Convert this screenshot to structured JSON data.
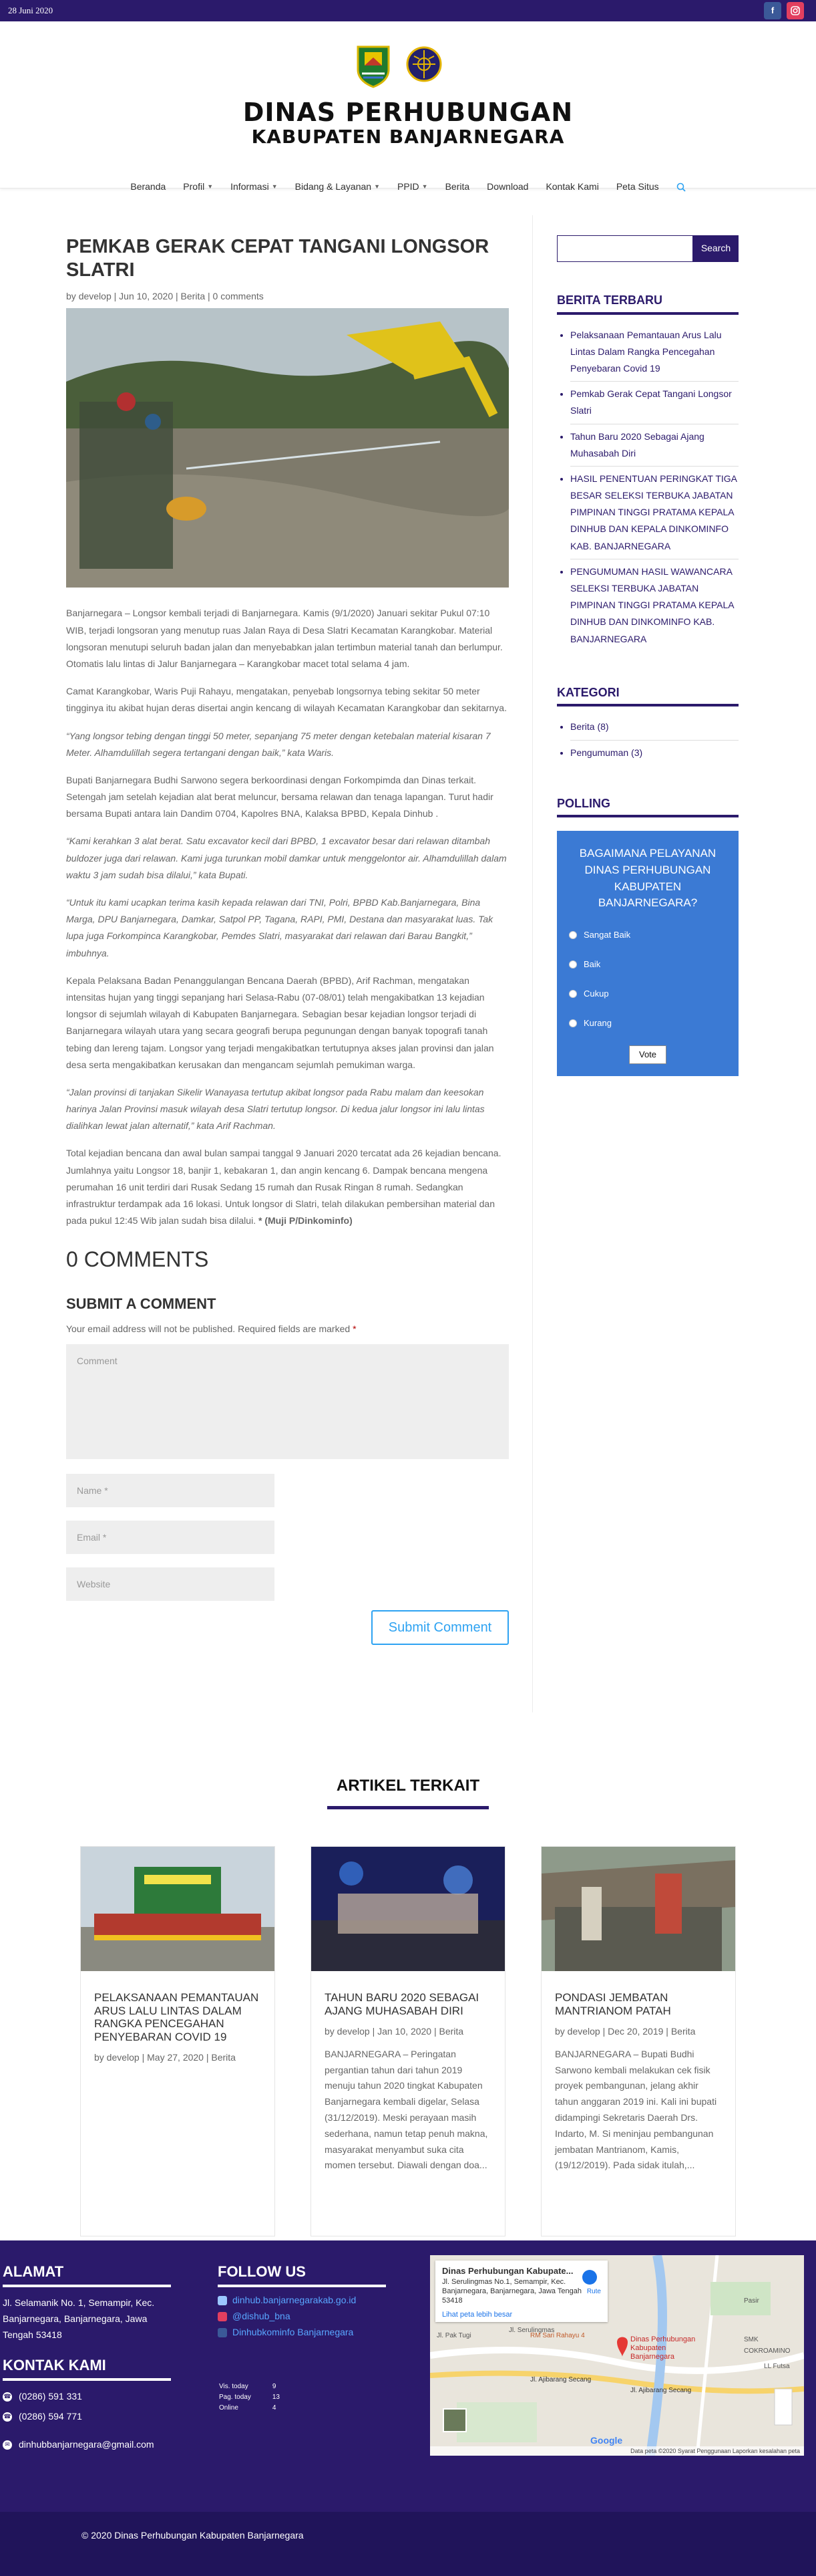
{
  "topbar": {
    "date": "28 Juni 2020",
    "facebook_icon": "facebook-icon",
    "instagram_icon": "instagram-icon"
  },
  "header": {
    "title_line1": "DINAS PERHUBUNGAN",
    "title_line2": "KABUPATEN BANJARNEGARA",
    "nav": [
      {
        "label": "Beranda"
      },
      {
        "label": "Profil"
      },
      {
        "label": "Informasi"
      },
      {
        "label": "Bidang & Layanan"
      },
      {
        "label": "PPID"
      },
      {
        "label": "Berita"
      },
      {
        "label": "Download"
      },
      {
        "label": "Kontak Kami"
      },
      {
        "label": "Peta Situs"
      }
    ]
  },
  "post": {
    "title": "PEMKAB GERAK CEPAT TANGANI LONGSOR SLATRI",
    "meta_author": "develop",
    "meta_date": "Jun 10, 2020",
    "meta_category": "Berita",
    "meta_comments": "0 comments",
    "sep": "|",
    "by": "by",
    "paragraphs": [
      {
        "text": "Banjarnegara – Longsor kembali terjadi di Banjarnegara. Kamis (9/1/2020) Januari sekitar Pukul 07:10 WIB, terjadi longsoran yang menutup ruas Jalan Raya di Desa Slatri Kecamatan Karangkobar. Material longsoran menutupi seluruh badan jalan dan menyebabkan jalan tertimbun material tanah dan berlumpur. Otomatis lalu lintas di Jalur Banjarnegara – Karangkobar macet total selama 4 jam.",
        "italic": false
      },
      {
        "text": "Camat Karangkobar, Waris Puji Rahayu, mengatakan, penyebab longsornya tebing sekitar 50 meter tingginya itu akibat hujan deras disertai angin kencang di wilayah Kecamatan Karangkobar dan sekitarnya.",
        "italic": false
      },
      {
        "text": "“Yang longsor tebing dengan tinggi 50 meter, sepanjang 75 meter dengan ketebalan material kisaran 7 Meter. Alhamdulillah segera tertangani dengan baik,” kata Waris.",
        "italic": true
      },
      {
        "text": "Bupati Banjarnegara Budhi Sarwono segera berkoordinasi dengan Forkompimda dan Dinas terkait. Setengah jam setelah kejadian alat berat meluncur, bersama relawan dan tenaga lapangan. Turut hadir bersama Bupati antara lain Dandim 0704, Kapolres BNA, Kalaksa BPBD, Kepala Dinhub .",
        "italic": false
      },
      {
        "text": "“Kami kerahkan 3 alat berat. Satu excavator kecil dari BPBD, 1 excavator besar dari relawan ditambah buldozer juga dari relawan. Kami juga turunkan mobil damkar untuk menggelontor air. Alhamdulillah dalam waktu 3 jam sudah bisa dilalui,” kata Bupati.",
        "italic": true
      },
      {
        "text": "“Untuk itu kami ucapkan terima kasih kepada relawan dari TNI, Polri, BPBD Kab.Banjarnegara, Bina Marga, DPU Banjarnegara, Damkar, Satpol PP, Tagana, RAPI, PMI, Destana dan masyarakat luas. Tak lupa juga Forkompinca Karangkobar, Pemdes Slatri, masyarakat dari relawan dari Barau Bangkit,” imbuhnya.",
        "italic": true
      },
      {
        "text": "Kepala Pelaksana Badan Penanggulangan Bencana Daerah (BPBD), Arif Rachman, mengatakan intensitas hujan yang tinggi sepanjang hari Selasa-Rabu (07-08/01) telah mengakibatkan 13 kejadian longsor di sejumlah wilayah di Kabupaten Banjarnegara. Sebagian besar kejadian longsor terjadi di Banjarnegara wilayah utara yang secara geografi berupa pegunungan dengan banyak topografi tanah tebing dan lereng tajam. Longsor yang terjadi mengakibatkan tertutupnya akses jalan provinsi dan jalan desa serta mengakibatkan kerusakan dan mengancam sejumlah pemukiman warga.",
        "italic": false
      },
      {
        "text": "“Jalan provinsi di tanjakan Sikelir Wanayasa tertutup akibat longsor pada Rabu malam dan keesokan harinya Jalan Provinsi masuk wilayah desa Slatri tertutup longsor. Di kedua jalur longsor ini lalu lintas dialihkan lewat jalan alternatif,” kata Arif Rachman.",
        "italic": true
      },
      {
        "text": "Total kejadian bencana dan awal bulan sampai tanggal 9 Januari 2020 tercatat ada 26 kejadian bencana. Jumlahnya yaitu Longsor 18, banjir 1, kebakaran 1, dan angin kencang 6. Dampak bencana mengena perumahan 16 unit terdiri dari Rusak Sedang 15 rumah dan Rusak Ringan 8 rumah. Sedangkan infrastruktur terdampak ada 16 lokasi. Untuk longsor di Slatri, telah dilakukan pembersihan material dan pada pukul 12:45 Wib jalan sudah bisa dilalui.",
        "italic": false,
        "credit": " * (Muji P/Dinkominfo)"
      }
    ]
  },
  "comments": {
    "heading": "0 COMMENTS",
    "submit_heading": "SUBMIT A COMMENT",
    "note": "Your email address will not be published. Required fields are marked",
    "required_mark": "*",
    "comment_placeholder": "Comment",
    "name_placeholder": "Name *",
    "email_placeholder": "Email *",
    "website_placeholder": "Website",
    "submit_label": "Submit Comment"
  },
  "sidebar": {
    "search_button": "Search",
    "recent_heading": "BERITA TERBARU",
    "recent": [
      "Pelaksanaan Pemantauan Arus Lalu Lintas Dalam Rangka Pencegahan Penyebaran Covid 19",
      "Pemkab Gerak Cepat Tangani Longsor Slatri",
      "Tahun Baru 2020 Sebagai Ajang Muhasabah Diri",
      "HASIL PENENTUAN PERINGKAT TIGA BESAR SELEKSI TERBUKA JABATAN PIMPINAN TINGGI PRATAMA KEPALA DINHUB DAN KEPALA DINKOMINFO KAB. BANJARNEGARA",
      "PENGUMUMAN HASIL WAWANCARA SELEKSI TERBUKA JABATAN PIMPINAN TINGGI PRATAMA KEPALA DINHUB DAN DINKOMINFO KAB. BANJARNEGARA"
    ],
    "category_heading": "KATEGORI",
    "categories": [
      "Berita (8)",
      "Pengumuman (3)"
    ],
    "poll_heading": "POLLING",
    "poll_question": "BAGAIMANA PELAYANAN DINAS PERHUBUNGAN KABUPATEN BANJARNEGARA?",
    "poll_options": [
      "Sangat Baik",
      "Baik",
      "Cukup",
      "Kurang"
    ],
    "vote_label": "Vote"
  },
  "related": {
    "heading": "ARTIKEL TERKAIT",
    "cards": [
      {
        "title": "PELAKSANAAN PEMANTAUAN ARUS LALU LINTAS DALAM RANGKA PENCEGAHAN PENYEBARAN COVID 19",
        "meta": "by develop | May 27, 2020 | Berita",
        "excerpt": ""
      },
      {
        "title": "TAHUN BARU 2020 SEBAGAI AJANG MUHASABAH DIRI",
        "meta": "by develop | Jan 10, 2020 | Berita",
        "excerpt": "BANJARNEGARA – Peringatan pergantian tahun dari tahun 2019 menuju tahun 2020 tingkat Kabupaten Banjarnegara kembali digelar, Selasa (31/12/2019). Meski perayaan masih sederhana, namun tetap penuh makna, masyarakat menyambut suka cita momen tersebut. Diawali dengan doa..."
      },
      {
        "title": "PONDASI JEMBATAN MANTRIANOM PATAH",
        "meta": "by develop | Dec 20, 2019 | Berita",
        "excerpt": "BANJARNEGARA – Bupati Budhi Sarwono kembali melakukan cek fisik proyek pembangunan, jelang akhir tahun anggaran 2019 ini. Kali ini bupati didampingi Sekretaris Daerah Drs. Indarto, M. Si meninjau pembangunan jembatan Mantrianom, Kamis, (19/12/2019). Pada sidak itulah,..."
      }
    ]
  },
  "footer": {
    "address_heading": "ALAMAT",
    "address": "Jl. Selamanik No. 1, Semampir, Kec. Banjarnegara, Banjarnegara, Jawa Tengah 53418",
    "contact_heading": "KONTAK KAMI",
    "phone1": "(0286) 591 331",
    "phone2": "(0286) 594 771",
    "email": "dinhubbanjarnegara@gmail.com",
    "follow_heading": "FOLLOW US",
    "follow_links": [
      "dinhub.banjarnegarakab.go.id",
      "@dishub_bna",
      "Dinhubkominfo Banjarnegara"
    ],
    "stats": [
      {
        "label": "Vis. today",
        "value": "9"
      },
      {
        "label": "Pag. today",
        "value": "13"
      },
      {
        "label": "Online",
        "value": "4"
      }
    ],
    "map_title": "Dinas Perhubungan Kabupate...",
    "map_address": "Jl. Serulingmas No.1, Semampir, Kec. Banjarnegara, Banjarnegara, Jawa Tengah 53418",
    "map_link": "Lihat peta lebih besar",
    "map_route": "Rute",
    "map_pin_label": "Dinas Perhubungan Kabupaten Banjarnegara",
    "map_roads": [
      "Jl. Serulingmas",
      "Jl. Ajibarang Secang",
      "Jl. Ajibarang Secang",
      "RM Sari Rahayu 4",
      "SMK COKROAMINO",
      "LL Futsa",
      "Pasir",
      "Jl. Pak Tugi"
    ],
    "map_footer": "Data peta ©2020   Syarat Penggunaan   Laporkan kesalahan peta",
    "google": "Google",
    "copyright": "© 2020 Dinas Perhubungan Kabupaten Banjarnegara"
  }
}
